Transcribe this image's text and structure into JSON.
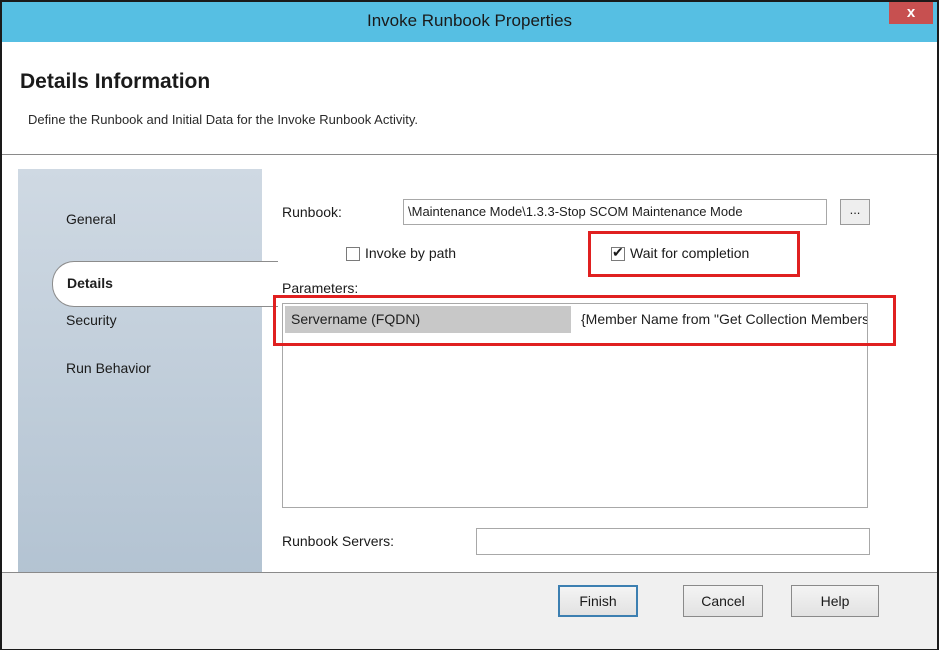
{
  "window": {
    "title": "Invoke Runbook Properties",
    "close_label": "x"
  },
  "header": {
    "title": "Details Information",
    "subtitle": "Define the Runbook and Initial Data for the Invoke Runbook Activity."
  },
  "sidebar": {
    "items": [
      {
        "label": "General"
      },
      {
        "label": "Details"
      },
      {
        "label": "Security"
      },
      {
        "label": "Run Behavior"
      }
    ],
    "selected": "Details"
  },
  "details": {
    "runbook_label": "Runbook:",
    "runbook_value": "\\Maintenance Mode\\1.3.3-Stop SCOM Maintenance Mode",
    "browse_label": "...",
    "invoke_by_path": {
      "label": "Invoke by path",
      "checked": false
    },
    "wait_for_completion": {
      "label": "Wait for completion",
      "checked": true
    },
    "parameters_label": "Parameters:",
    "parameters": [
      {
        "name": "Servername (FQDN)",
        "value": "{Member Name from \"Get Collection Members\"}"
      }
    ],
    "runbook_servers_label": "Runbook Servers:",
    "runbook_servers_value": ""
  },
  "footer": {
    "finish_label": "Finish",
    "cancel_label": "Cancel",
    "help_label": "Help"
  },
  "colors": {
    "titlebar": "#56bfe3",
    "highlight": "#e02020",
    "accent_button": "#3c7fb1"
  }
}
